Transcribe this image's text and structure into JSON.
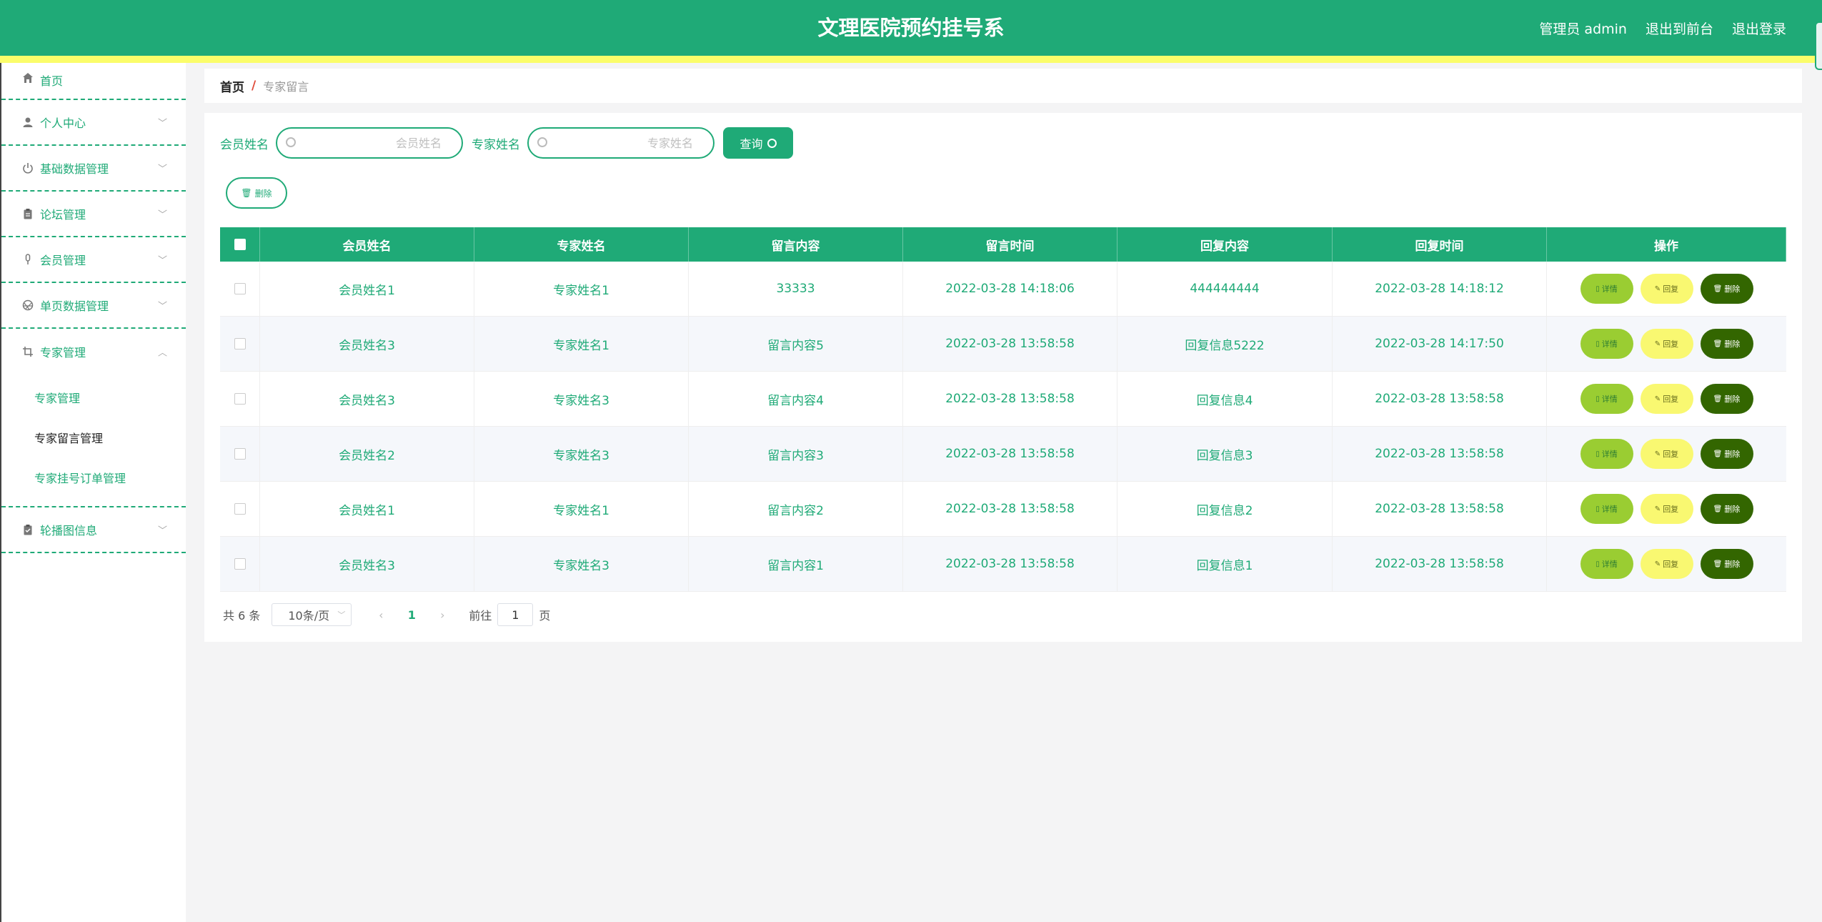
{
  "header": {
    "title": "文理医院预约挂号系",
    "user": "管理员 admin",
    "to_front": "退出到前台",
    "logout": "退出登录"
  },
  "sidebar": {
    "items": [
      {
        "label": "首页",
        "icon": "home-icon"
      },
      {
        "label": "个人中心",
        "icon": "user-icon"
      },
      {
        "label": "基础数据管理",
        "icon": "power-icon"
      },
      {
        "label": "论坛管理",
        "icon": "clipboard-icon"
      },
      {
        "label": "会员管理",
        "icon": "microphone-icon"
      },
      {
        "label": "单页数据管理",
        "icon": "aperture-icon"
      },
      {
        "label": "专家管理",
        "icon": "crop-icon"
      },
      {
        "label": "轮播图信息",
        "icon": "checklist-icon"
      }
    ],
    "sub_items": [
      "专家管理",
      "专家留言管理",
      "专家挂号订单管理"
    ]
  },
  "breadcrumb": {
    "home": "首页",
    "sep": "/",
    "current": "专家留言"
  },
  "search": {
    "member_label": "会员姓名",
    "member_placeholder": "会员姓名",
    "expert_label": "专家姓名",
    "expert_placeholder": "专家姓名",
    "query_label": "查询"
  },
  "toolbar": {
    "delete_label": "删除"
  },
  "table": {
    "headers": [
      "会员姓名",
      "专家姓名",
      "留言内容",
      "留言时间",
      "回复内容",
      "回复时间",
      "操作"
    ],
    "actions": {
      "detail": "详情",
      "reply": "回复",
      "delete": "删除"
    },
    "rows": [
      [
        "会员姓名1",
        "专家姓名1",
        "33333",
        "2022-03-28 14:18:06",
        "444444444",
        "2022-03-28 14:18:12"
      ],
      [
        "会员姓名3",
        "专家姓名1",
        "留言内容5",
        "2022-03-28 13:58:58",
        "回复信息5222",
        "2022-03-28 14:17:50"
      ],
      [
        "会员姓名3",
        "专家姓名3",
        "留言内容4",
        "2022-03-28 13:58:58",
        "回复信息4",
        "2022-03-28 13:58:58"
      ],
      [
        "会员姓名2",
        "专家姓名3",
        "留言内容3",
        "2022-03-28 13:58:58",
        "回复信息3",
        "2022-03-28 13:58:58"
      ],
      [
        "会员姓名1",
        "专家姓名1",
        "留言内容2",
        "2022-03-28 13:58:58",
        "回复信息2",
        "2022-03-28 13:58:58"
      ],
      [
        "会员姓名3",
        "专家姓名3",
        "留言内容1",
        "2022-03-28 13:58:58",
        "回复信息1",
        "2022-03-28 13:58:58"
      ]
    ]
  },
  "pagination": {
    "total": "共 6 条",
    "page_size": "10条/页",
    "current_page": "1",
    "goto_prefix": "前往",
    "goto_value": "1",
    "goto_suffix": "页"
  },
  "colors": {
    "primary": "#1faa77",
    "stripe": "#fbfd6a",
    "detail": "#9acd32",
    "reply": "#f9f871",
    "delete": "#336600"
  }
}
